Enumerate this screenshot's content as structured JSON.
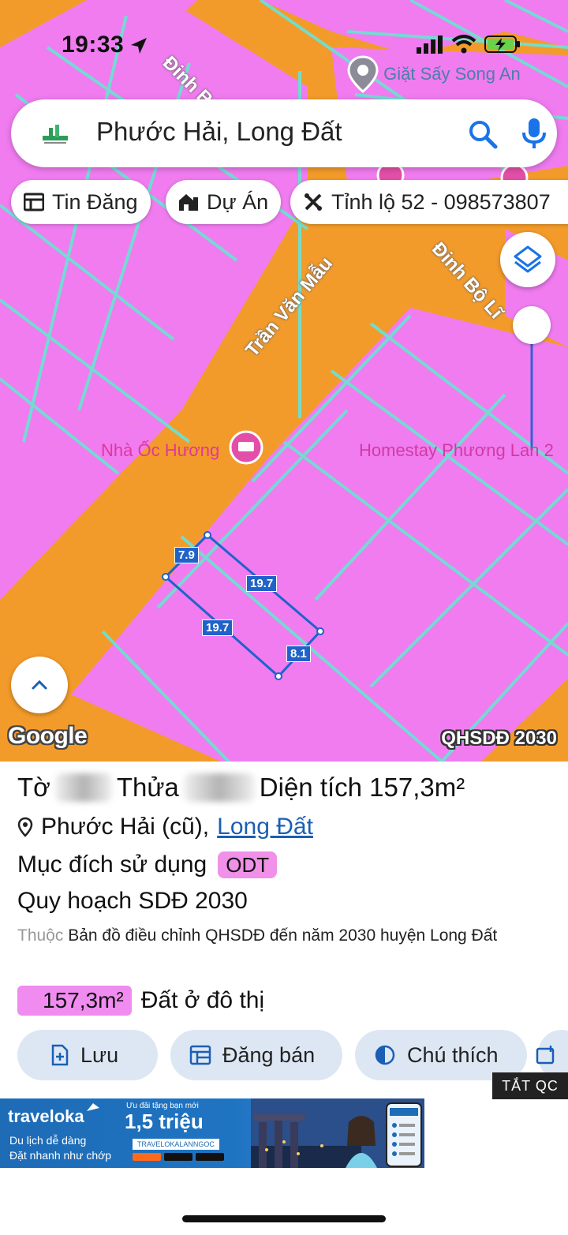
{
  "status_bar": {
    "time": "19:33"
  },
  "map": {
    "poi_top": "Giặt Sấy Song An",
    "streets": {
      "dinh_bo_linh_top": "Đinh Bộ Lĩ",
      "tran_van_mau": "Trần Văn Mẫu",
      "dinh_bo_linh_right": "Đinh Bộ Lĩ"
    },
    "poi_nha_oc": "Nhà Ốc Hương",
    "poi_homestay": "Homestay Phương Lan 2",
    "parcel_dims": {
      "top": "7.9",
      "right_long": "19.7",
      "left_long": "19.7",
      "bottom": "8.1"
    },
    "google_logo": "Google",
    "layer_label": "QHSDĐ 2030",
    "colors": {
      "residential": "#f07cf0",
      "road_land": "#f39b2a",
      "grid_line": "#6ee0d2",
      "parcel": "#1f63c9"
    }
  },
  "search": {
    "query": "Phước Hải, Long Đất"
  },
  "chips": {
    "tin_dang": "Tin Đăng",
    "du_an": "Dự Án",
    "route": "Tỉnh lộ 52 - 098573807"
  },
  "panel": {
    "to_label": "Tờ",
    "thua_label": "Thửa",
    "area_label": "Diện tích 157,3m²",
    "location": "Phước Hải (cũ),",
    "location_link": "Long Đất",
    "purpose_label": "Mục đích sử dụng",
    "purpose_code": "ODT",
    "plan_title": "Quy hoạch SDĐ 2030",
    "plan_source_prefix": "Thuộc",
    "plan_source": "Bản đồ điều chỉnh QHSDĐ đến năm 2030 huyện Long Đất",
    "area_value": "157,3m²",
    "area_type": "Đất ở đô thị"
  },
  "actions": {
    "save": "Lưu",
    "post_sale": "Đăng bán",
    "legend": "Chú thích"
  },
  "ad": {
    "close": "TẮT QC",
    "brand": "traveloka",
    "line1": "Du lịch dễ dàng",
    "line2": "Đặt nhanh như chớp",
    "promo_small": "Ưu đãi tặng bạn mới",
    "amount": "1,5 triệu",
    "code": "TRAVELOKALANNGOC"
  }
}
